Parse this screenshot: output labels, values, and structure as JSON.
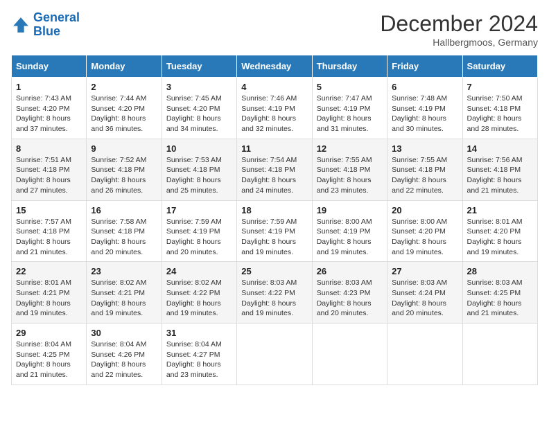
{
  "logo": {
    "line1": "General",
    "line2": "Blue"
  },
  "title": "December 2024",
  "location": "Hallbergmoos, Germany",
  "header": {
    "days": [
      "Sunday",
      "Monday",
      "Tuesday",
      "Wednesday",
      "Thursday",
      "Friday",
      "Saturday"
    ]
  },
  "weeks": [
    [
      {
        "num": "1",
        "sunrise": "7:43 AM",
        "sunset": "4:20 PM",
        "daylight": "8 hours and 37 minutes."
      },
      {
        "num": "2",
        "sunrise": "7:44 AM",
        "sunset": "4:20 PM",
        "daylight": "8 hours and 36 minutes."
      },
      {
        "num": "3",
        "sunrise": "7:45 AM",
        "sunset": "4:20 PM",
        "daylight": "8 hours and 34 minutes."
      },
      {
        "num": "4",
        "sunrise": "7:46 AM",
        "sunset": "4:19 PM",
        "daylight": "8 hours and 32 minutes."
      },
      {
        "num": "5",
        "sunrise": "7:47 AM",
        "sunset": "4:19 PM",
        "daylight": "8 hours and 31 minutes."
      },
      {
        "num": "6",
        "sunrise": "7:48 AM",
        "sunset": "4:19 PM",
        "daylight": "8 hours and 30 minutes."
      },
      {
        "num": "7",
        "sunrise": "7:50 AM",
        "sunset": "4:18 PM",
        "daylight": "8 hours and 28 minutes."
      }
    ],
    [
      {
        "num": "8",
        "sunrise": "7:51 AM",
        "sunset": "4:18 PM",
        "daylight": "8 hours and 27 minutes."
      },
      {
        "num": "9",
        "sunrise": "7:52 AM",
        "sunset": "4:18 PM",
        "daylight": "8 hours and 26 minutes."
      },
      {
        "num": "10",
        "sunrise": "7:53 AM",
        "sunset": "4:18 PM",
        "daylight": "8 hours and 25 minutes."
      },
      {
        "num": "11",
        "sunrise": "7:54 AM",
        "sunset": "4:18 PM",
        "daylight": "8 hours and 24 minutes."
      },
      {
        "num": "12",
        "sunrise": "7:55 AM",
        "sunset": "4:18 PM",
        "daylight": "8 hours and 23 minutes."
      },
      {
        "num": "13",
        "sunrise": "7:55 AM",
        "sunset": "4:18 PM",
        "daylight": "8 hours and 22 minutes."
      },
      {
        "num": "14",
        "sunrise": "7:56 AM",
        "sunset": "4:18 PM",
        "daylight": "8 hours and 21 minutes."
      }
    ],
    [
      {
        "num": "15",
        "sunrise": "7:57 AM",
        "sunset": "4:18 PM",
        "daylight": "8 hours and 21 minutes."
      },
      {
        "num": "16",
        "sunrise": "7:58 AM",
        "sunset": "4:18 PM",
        "daylight": "8 hours and 20 minutes."
      },
      {
        "num": "17",
        "sunrise": "7:59 AM",
        "sunset": "4:19 PM",
        "daylight": "8 hours and 20 minutes."
      },
      {
        "num": "18",
        "sunrise": "7:59 AM",
        "sunset": "4:19 PM",
        "daylight": "8 hours and 19 minutes."
      },
      {
        "num": "19",
        "sunrise": "8:00 AM",
        "sunset": "4:19 PM",
        "daylight": "8 hours and 19 minutes."
      },
      {
        "num": "20",
        "sunrise": "8:00 AM",
        "sunset": "4:20 PM",
        "daylight": "8 hours and 19 minutes."
      },
      {
        "num": "21",
        "sunrise": "8:01 AM",
        "sunset": "4:20 PM",
        "daylight": "8 hours and 19 minutes."
      }
    ],
    [
      {
        "num": "22",
        "sunrise": "8:01 AM",
        "sunset": "4:21 PM",
        "daylight": "8 hours and 19 minutes."
      },
      {
        "num": "23",
        "sunrise": "8:02 AM",
        "sunset": "4:21 PM",
        "daylight": "8 hours and 19 minutes."
      },
      {
        "num": "24",
        "sunrise": "8:02 AM",
        "sunset": "4:22 PM",
        "daylight": "8 hours and 19 minutes."
      },
      {
        "num": "25",
        "sunrise": "8:03 AM",
        "sunset": "4:22 PM",
        "daylight": "8 hours and 19 minutes."
      },
      {
        "num": "26",
        "sunrise": "8:03 AM",
        "sunset": "4:23 PM",
        "daylight": "8 hours and 20 minutes."
      },
      {
        "num": "27",
        "sunrise": "8:03 AM",
        "sunset": "4:24 PM",
        "daylight": "8 hours and 20 minutes."
      },
      {
        "num": "28",
        "sunrise": "8:03 AM",
        "sunset": "4:25 PM",
        "daylight": "8 hours and 21 minutes."
      }
    ],
    [
      {
        "num": "29",
        "sunrise": "8:04 AM",
        "sunset": "4:25 PM",
        "daylight": "8 hours and 21 minutes."
      },
      {
        "num": "30",
        "sunrise": "8:04 AM",
        "sunset": "4:26 PM",
        "daylight": "8 hours and 22 minutes."
      },
      {
        "num": "31",
        "sunrise": "8:04 AM",
        "sunset": "4:27 PM",
        "daylight": "8 hours and 23 minutes."
      },
      null,
      null,
      null,
      null
    ]
  ]
}
